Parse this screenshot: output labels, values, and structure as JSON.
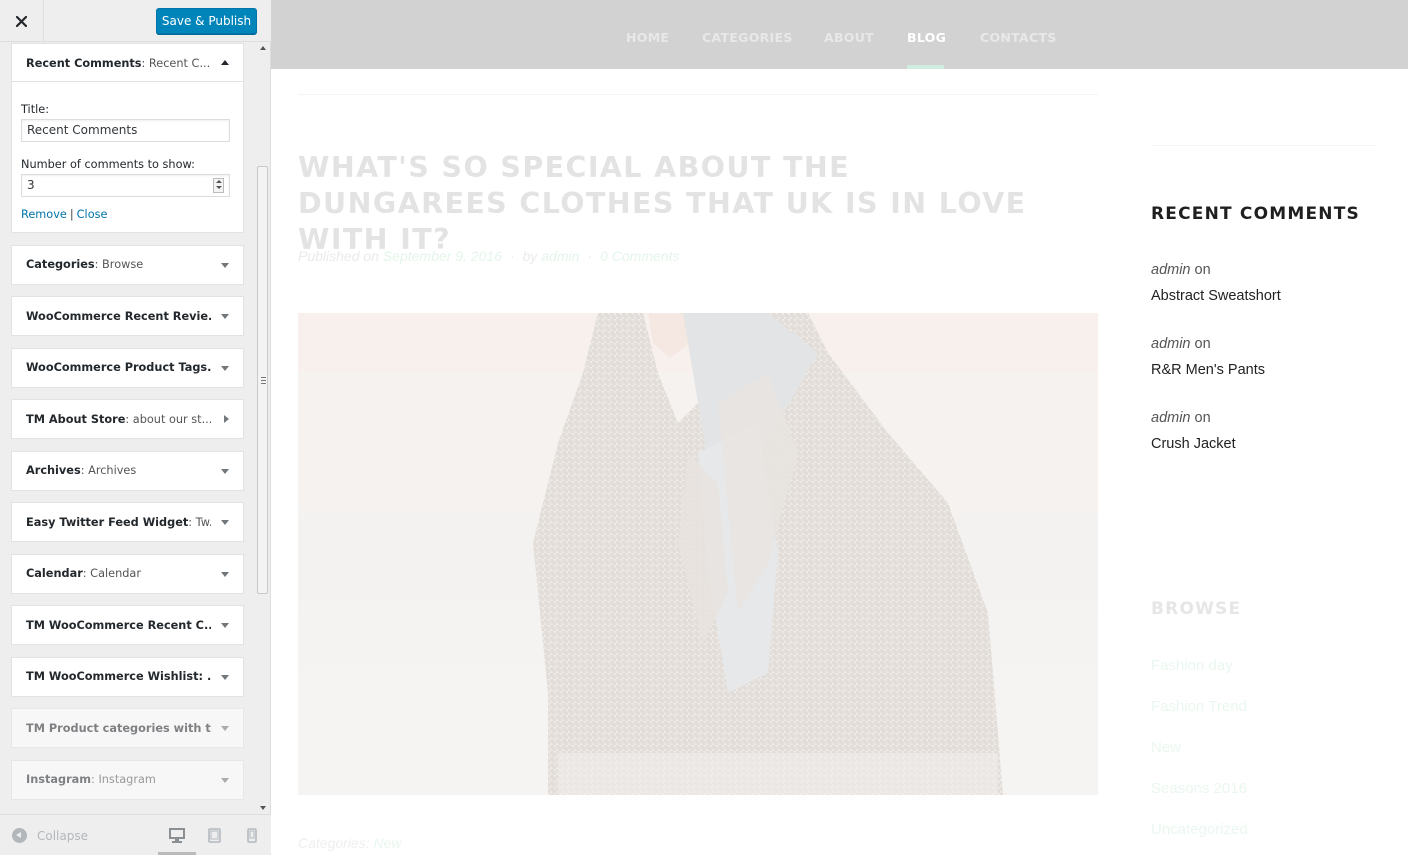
{
  "customizer": {
    "save_label": "Save & Publish",
    "open_widget": {
      "name": "Recent Comments",
      "subtitle": ": Recent C...",
      "title_label": "Title:",
      "title_value": "Recent Comments",
      "count_label": "Number of comments to show:",
      "count_value": "3",
      "remove_label": "Remove",
      "separator": "|",
      "close_label": "Close"
    },
    "widgets": [
      {
        "name": "Categories",
        "subtitle": ": Browse",
        "arrow": "down"
      },
      {
        "name": "WooCommerce Recent Revie...",
        "subtitle": "",
        "arrow": "down"
      },
      {
        "name": "WooCommerce Product Tags...",
        "subtitle": "",
        "arrow": "down"
      },
      {
        "name": "TM About Store",
        "subtitle": ": about our st...",
        "arrow": "right"
      },
      {
        "name": "Archives",
        "subtitle": ": Archives",
        "arrow": "down"
      },
      {
        "name": "Easy Twitter Feed Widget",
        "subtitle": ": Tw...",
        "arrow": "down"
      },
      {
        "name": "Calendar",
        "subtitle": ": Calendar",
        "arrow": "down"
      },
      {
        "name": "TM WooCommerce Recent C...",
        "subtitle": "",
        "arrow": "down"
      },
      {
        "name": "TM WooCommerce Wishlist: ...",
        "subtitle": "",
        "arrow": "down"
      },
      {
        "name": "TM Product categories with t...",
        "subtitle": "",
        "arrow": "down",
        "faded": true
      },
      {
        "name": "Instagram",
        "subtitle": ": Instagram",
        "arrow": "down",
        "faded": true
      }
    ],
    "collapse_label": "Collapse",
    "preview_devices": [
      "desktop-icon",
      "tablet-icon",
      "mobile-icon"
    ]
  },
  "preview": {
    "nav": [
      "HOME",
      "CATEGORIES",
      "ABOUT",
      "BLOG",
      "CONTACTS"
    ],
    "nav_active": "BLOG",
    "post": {
      "title": "WHAT'S SO SPECIAL ABOUT THE DUNGAREES CLOTHES THAT UK IS IN LOVE WITH IT?",
      "published_prefix": "Published on",
      "date": "September 9, 2016",
      "by_prefix": "by",
      "author": "admin",
      "comments": "0 Comments",
      "categories_prefix": "Categories:",
      "category": "New"
    },
    "recent_comments": {
      "title": "RECENT COMMENTS",
      "on_word": "on",
      "items": [
        {
          "author": "admin",
          "post": "Abstract Sweatshort"
        },
        {
          "author": "admin",
          "post": "R&R Men's Pants"
        },
        {
          "author": "admin",
          "post": "Crush Jacket"
        }
      ]
    },
    "browse": {
      "title": "BROWSE",
      "items": [
        "Fashion day",
        "Fashion Trend",
        "New",
        "Seasons 2016",
        "Uncategorized"
      ]
    }
  },
  "colors": {
    "primary_button": "#0085ba",
    "link": "#0073aa",
    "nav_bar": "#d2d2d2",
    "nav_active_underline": "#cfeee0",
    "sidebar_bg": "#eeeeee"
  }
}
